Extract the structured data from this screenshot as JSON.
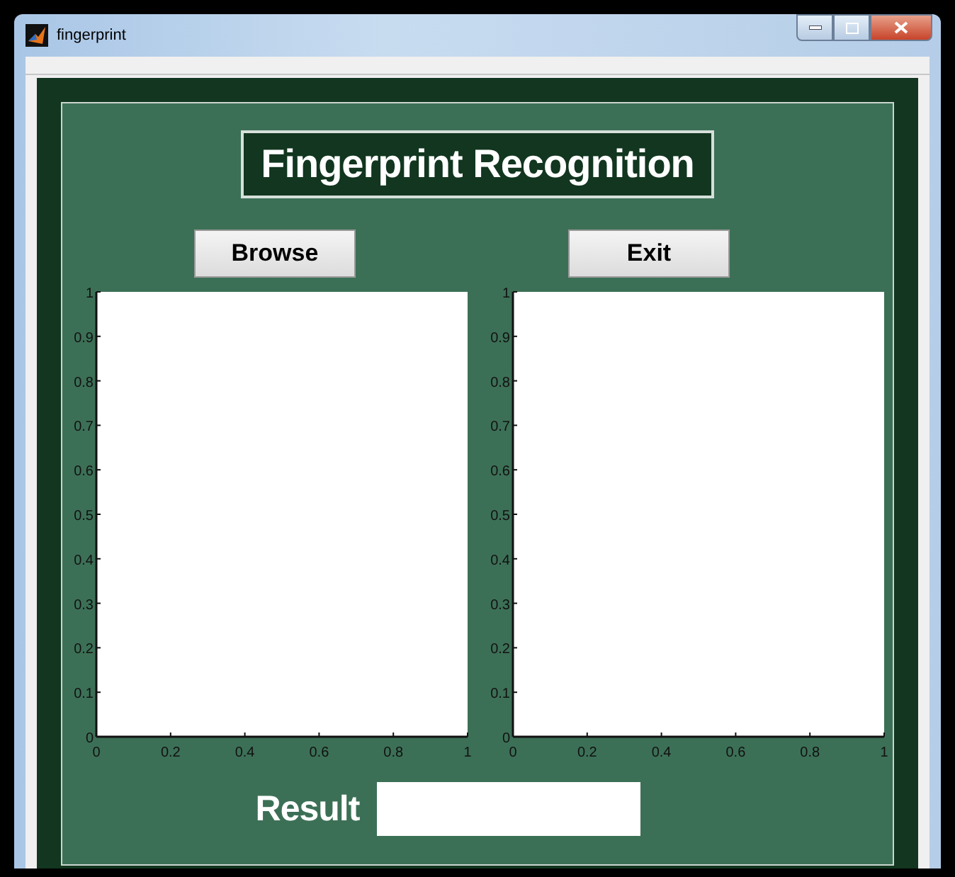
{
  "window": {
    "title": "fingerprint"
  },
  "heading": "Fingerprint Recognition",
  "buttons": [
    {
      "label": "Browse"
    },
    {
      "label": "Exit"
    }
  ],
  "axes": [
    {
      "chart_data": {
        "type": "line",
        "xlim": [
          0,
          1
        ],
        "ylim": [
          0,
          1
        ],
        "xticks": [
          0,
          0.2,
          0.4,
          0.6,
          0.8,
          1
        ],
        "yticks": [
          0,
          0.1,
          0.2,
          0.3,
          0.4,
          0.5,
          0.6,
          0.7,
          0.8,
          0.9,
          1
        ]
      }
    },
    {
      "chart_data": {
        "type": "line",
        "xlim": [
          0,
          1
        ],
        "ylim": [
          0,
          1
        ],
        "xticks": [
          0,
          0.2,
          0.4,
          0.6,
          0.8,
          1
        ],
        "yticks": [
          0,
          0.1,
          0.2,
          0.3,
          0.4,
          0.5,
          0.6,
          0.7,
          0.8,
          0.9,
          1
        ]
      }
    }
  ],
  "result": {
    "label": "Result"
  }
}
